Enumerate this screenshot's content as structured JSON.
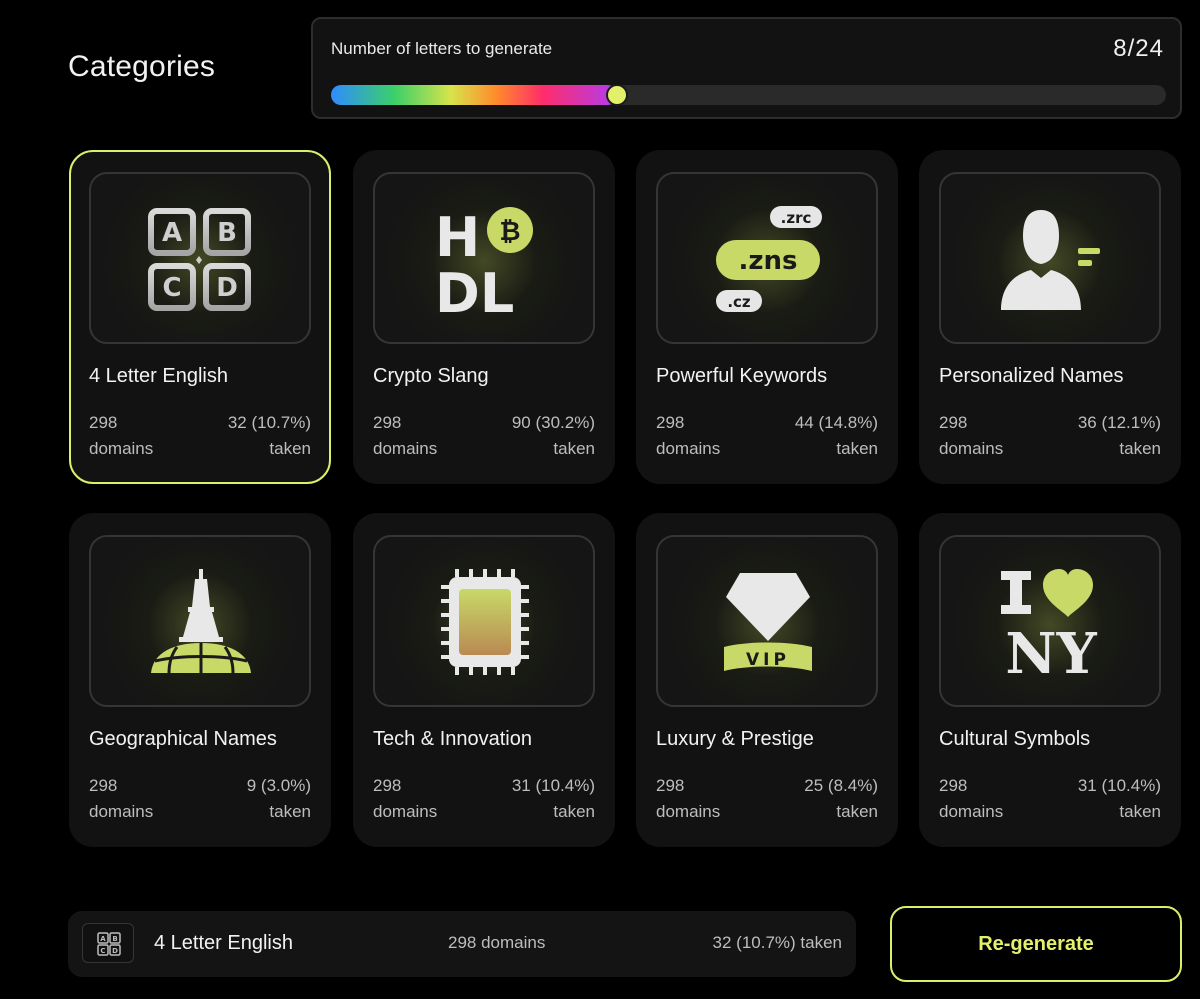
{
  "header": {
    "title": "Categories"
  },
  "slider": {
    "label": "Number of letters to generate",
    "count": "8/24",
    "value": 8,
    "max": 24
  },
  "categories": [
    {
      "name": "4 Letter English",
      "domains": "298",
      "domains_unit": "domains",
      "taken": "32 (10.7%)",
      "taken_unit": "taken",
      "icon": "abcd-blocks-icon",
      "selected": true
    },
    {
      "name": "Crypto Slang",
      "domains": "298",
      "domains_unit": "domains",
      "taken": "90 (30.2%)",
      "taken_unit": "taken",
      "icon": "hodl-bitcoin-icon",
      "selected": false
    },
    {
      "name": "Powerful Keywords",
      "domains": "298",
      "domains_unit": "domains",
      "taken": "44 (14.8%)",
      "taken_unit": "taken",
      "icon": "domain-tags-icon",
      "selected": false,
      "icon_text": {
        "top": ".zrc",
        "middle": ".zns",
        "bottom": ".cz"
      }
    },
    {
      "name": "Personalized Names",
      "domains": "298",
      "domains_unit": "domains",
      "taken": "36 (12.1%)",
      "taken_unit": "taken",
      "icon": "person-silhouette-icon",
      "selected": false
    },
    {
      "name": "Geographical Names",
      "domains": "298",
      "domains_unit": "domains",
      "taken": "9 (3.0%)",
      "taken_unit": "taken",
      "icon": "eiffel-tower-globe-icon",
      "selected": false
    },
    {
      "name": "Tech & Innovation",
      "domains": "298",
      "domains_unit": "domains",
      "taken": "31 (10.4%)",
      "taken_unit": "taken",
      "icon": "microchip-icon",
      "selected": false
    },
    {
      "name": "Luxury & Prestige",
      "domains": "298",
      "domains_unit": "domains",
      "taken": "25 (8.4%)",
      "taken_unit": "taken",
      "icon": "diamond-vip-icon",
      "selected": false,
      "icon_text": {
        "banner": "VIP"
      }
    },
    {
      "name": "Cultural Symbols",
      "domains": "298",
      "domains_unit": "domains",
      "taken": "31 (10.4%)",
      "taken_unit": "taken",
      "icon": "i-love-ny-icon",
      "selected": false
    }
  ],
  "footer": {
    "name": "4 Letter English",
    "domains": "298 domains",
    "taken": "32 (10.7%) taken",
    "icon": "abcd-blocks-icon",
    "regenerate_label": "Re-generate"
  },
  "colors": {
    "accent": "#dcef6a",
    "background": "#000000",
    "card": "#121212",
    "icon_green": "#c8d968"
  }
}
